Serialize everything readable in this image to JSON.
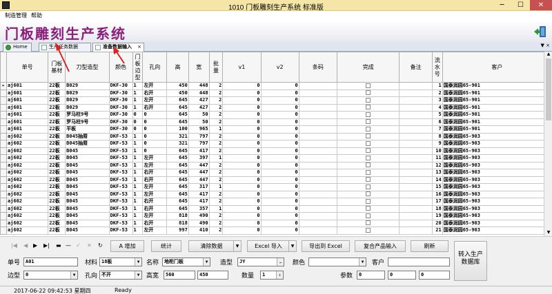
{
  "window": {
    "title": "1010 门板雕刻生产系统 标准版"
  },
  "menu": [
    "制造管理",
    "帮助"
  ],
  "banner": {
    "heading": "门板雕刻生产系统"
  },
  "tabs": [
    {
      "label": "Home"
    },
    {
      "label": "生产任务数据"
    },
    {
      "label": "准备数据输入",
      "active": true,
      "close": "×"
    }
  ],
  "grid": {
    "headers": [
      "单号",
      "门板\n基材",
      "刀型造型",
      "颜色",
      "门\n板\n边\n型",
      "孔向",
      "高",
      "宽",
      "批\n量",
      "v1",
      "v2",
      "条码",
      "完成",
      "备注",
      "流\n水\n号",
      "客户"
    ],
    "rows": [
      [
        "aj601",
        "22板",
        "B029",
        "DKF-30",
        "1",
        "左开",
        "450",
        "448",
        "2",
        "0",
        "0",
        "",
        "",
        "",
        "1",
        "国泰润园65-901"
      ],
      [
        "aj601",
        "22板",
        "B029",
        "DKF-30",
        "1",
        "右开",
        "450",
        "448",
        "2",
        "0",
        "0",
        "",
        "",
        "",
        "2",
        "国泰润园65-901"
      ],
      [
        "aj601",
        "22板",
        "B029",
        "DKF-30",
        "1",
        "左开",
        "645",
        "427",
        "2",
        "0",
        "0",
        "",
        "",
        "",
        "3",
        "国泰润园65-901"
      ],
      [
        "aj601",
        "22板",
        "B029",
        "DKF-30",
        "1",
        "右开",
        "645",
        "427",
        "2",
        "0",
        "0",
        "",
        "",
        "",
        "4",
        "国泰润园65-901"
      ],
      [
        "aj601",
        "22板",
        "罗马柱9号",
        "DKF-30",
        "0",
        "0",
        "645",
        "50",
        "2",
        "0",
        "0",
        "",
        "",
        "",
        "5",
        "国泰润园65-901"
      ],
      [
        "aj601",
        "22板",
        "罗马柱9号",
        "DKF-30",
        "0",
        "0",
        "645",
        "50",
        "2",
        "0",
        "0",
        "",
        "",
        "",
        "6",
        "国泰润园65-901"
      ],
      [
        "aj601",
        "22板",
        "平板",
        "DKF-30",
        "0",
        "0",
        "100",
        "965",
        "1",
        "0",
        "0",
        "",
        "",
        "",
        "7",
        "国泰润园65-901"
      ],
      [
        "aj602",
        "22板",
        "B045抽屉",
        "DKF-53",
        "1",
        "0",
        "321",
        "797",
        "2",
        "0",
        "0",
        "",
        "",
        "",
        "8",
        "国泰润园65-903"
      ],
      [
        "aj602",
        "22板",
        "B045抽屉",
        "DKF-53",
        "1",
        "0",
        "321",
        "797",
        "2",
        "0",
        "0",
        "",
        "",
        "",
        "9",
        "国泰润园65-903"
      ],
      [
        "aj602",
        "22板",
        "B045",
        "DKF-53",
        "1",
        "0",
        "645",
        "417",
        "2",
        "0",
        "0",
        "",
        "",
        "",
        "10",
        "国泰润园65-903"
      ],
      [
        "aj602",
        "22板",
        "B045",
        "DKF-53",
        "1",
        "左开",
        "645",
        "397",
        "1",
        "0",
        "0",
        "",
        "",
        "",
        "11",
        "国泰润园65-903"
      ],
      [
        "aj602",
        "22板",
        "B045",
        "DKF-53",
        "1",
        "左开",
        "645",
        "447",
        "2",
        "0",
        "0",
        "",
        "",
        "",
        "12",
        "国泰润园65-903"
      ],
      [
        "aj602",
        "22板",
        "B045",
        "DKF-53",
        "1",
        "右开",
        "645",
        "447",
        "2",
        "0",
        "0",
        "",
        "",
        "",
        "13",
        "国泰润园65-903"
      ],
      [
        "aj602",
        "22板",
        "B045",
        "DKF-53",
        "1",
        "右开",
        "645",
        "447",
        "2",
        "0",
        "0",
        "",
        "",
        "",
        "14",
        "国泰润园65-903"
      ],
      [
        "aj602",
        "22板",
        "B045",
        "DKF-53",
        "1",
        "左开",
        "645",
        "317",
        "1",
        "0",
        "0",
        "",
        "",
        "",
        "15",
        "国泰润园65-903"
      ],
      [
        "aj602",
        "22板",
        "B045",
        "DKF-53",
        "1",
        "左开",
        "645",
        "417",
        "2",
        "0",
        "0",
        "",
        "",
        "",
        "16",
        "国泰润园65-903"
      ],
      [
        "aj602",
        "22板",
        "B045",
        "DKF-53",
        "1",
        "右开",
        "645",
        "417",
        "2",
        "0",
        "0",
        "",
        "",
        "",
        "17",
        "国泰润园65-903"
      ],
      [
        "aj602",
        "22板",
        "B045",
        "DKF-53",
        "1",
        "右开",
        "645",
        "357",
        "1",
        "0",
        "0",
        "",
        "",
        "",
        "18",
        "国泰润园65-903"
      ],
      [
        "aj602",
        "22板",
        "B045",
        "DKF-53",
        "1",
        "左开",
        "818",
        "490",
        "2",
        "0",
        "0",
        "",
        "",
        "",
        "19",
        "国泰润园65-903"
      ],
      [
        "aj602",
        "22板",
        "B045",
        "DKF-53",
        "1",
        "右开",
        "818",
        "490",
        "2",
        "0",
        "0",
        "",
        "",
        "",
        "20",
        "国泰润园65-903"
      ],
      [
        "aj602",
        "22板",
        "B045",
        "DKF-53",
        "1",
        "左开",
        "997",
        "410",
        "2",
        "0",
        "0",
        "",
        "",
        "",
        "21",
        "国泰润园65-903"
      ]
    ]
  },
  "toolbar": {
    "add": "A 增加",
    "stats": "统计",
    "clear": "清除数据",
    "excel_import": "Excel 导入",
    "export_excel": "导出到 Excel",
    "copy_input": "复合产品输入",
    "refresh": "刷新",
    "transfer": "转入生产\n数据库"
  },
  "form": {
    "order_no_label": "单号",
    "order_no": "A01",
    "material_label": "材料",
    "material": "18板",
    "name_label": "名称",
    "name": "地柜门板",
    "model_label": "造型",
    "model": "JY",
    "color_label": "颜色",
    "color": "",
    "customer_label": "客户",
    "customer": "",
    "edge_label": "边型",
    "edge": "0",
    "hole_label": "孔向",
    "hole": "不开",
    "size_label": "高宽",
    "height": "560",
    "width": "450",
    "qty_label": "数量",
    "qty": "1",
    "param_label": "参数",
    "p1": "0",
    "p2": "0",
    "p3": "0"
  },
  "status": {
    "datetime": "2017-06-22 09:42:53 星期四",
    "state": "Ready"
  },
  "colors": {
    "title_bg": "#f5e6a8",
    "heading": "#8a1f7a",
    "close": "#c75050"
  }
}
